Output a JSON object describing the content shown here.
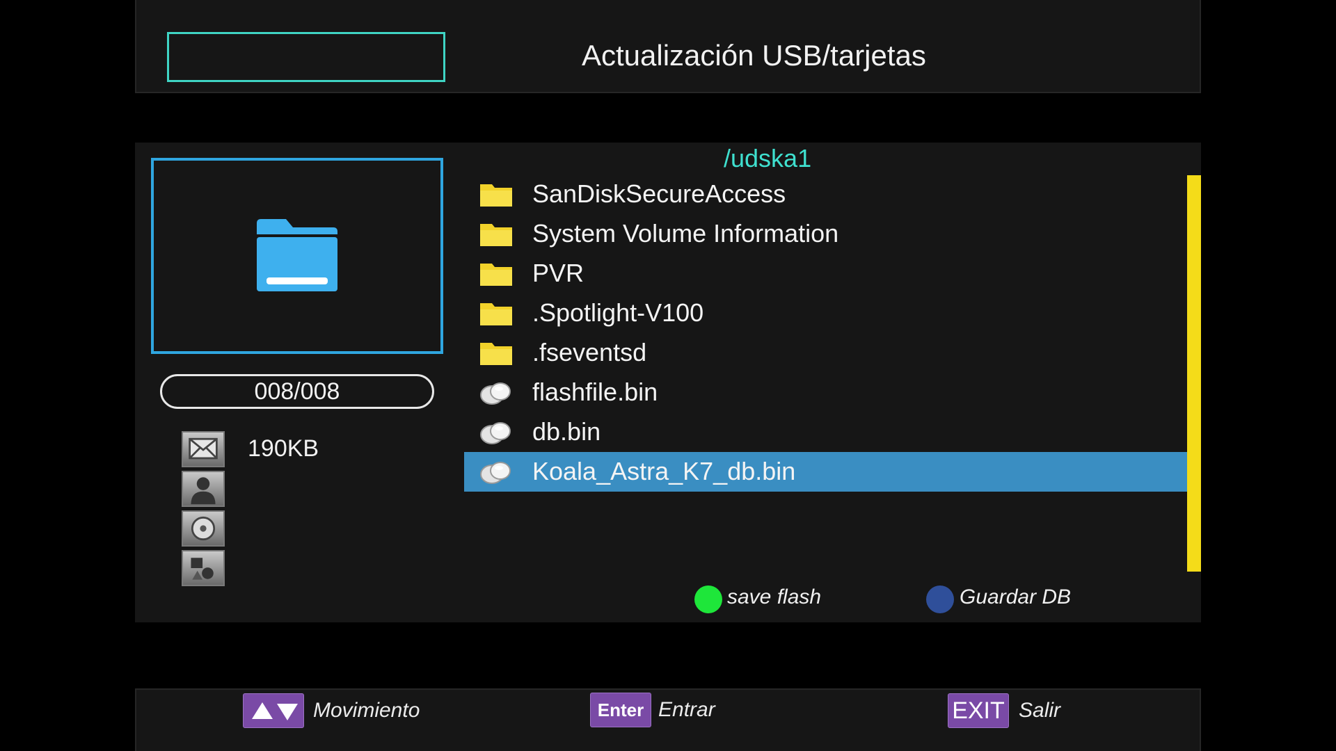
{
  "header": {
    "title": "Actualización USB/tarjetas"
  },
  "preview": {
    "counter": "008/008",
    "file_size": "190KB"
  },
  "file_browser": {
    "path": "/udska1",
    "items": [
      {
        "name": "SanDiskSecureAccess",
        "type": "folder"
      },
      {
        "name": "System Volume Information",
        "type": "folder"
      },
      {
        "name": "PVR",
        "type": "folder"
      },
      {
        "name": ".Spotlight-V100",
        "type": "folder"
      },
      {
        "name": ".fseventsd",
        "type": "folder"
      },
      {
        "name": "flashfile.bin",
        "type": "bin-file"
      },
      {
        "name": "db.bin",
        "type": "bin-file"
      },
      {
        "name": "Koala_Astra_K7_db.bin",
        "type": "bin-file",
        "selected": true
      }
    ]
  },
  "legend": {
    "green": {
      "label": "save flash",
      "color": "#1ee63a"
    },
    "blue": {
      "label": "Guardar DB",
      "color": "#2f4f9a"
    }
  },
  "footer": {
    "move_label": "Movimiento",
    "enter_key": "Enter",
    "enter_label": "Entrar",
    "exit_key": "EXIT",
    "exit_label": "Salir"
  },
  "colors": {
    "accent_teal": "#3fd4c4",
    "selection": "#3a8ec2",
    "scrollbar": "#f4dc19",
    "key_purple": "#7a4aa6"
  }
}
